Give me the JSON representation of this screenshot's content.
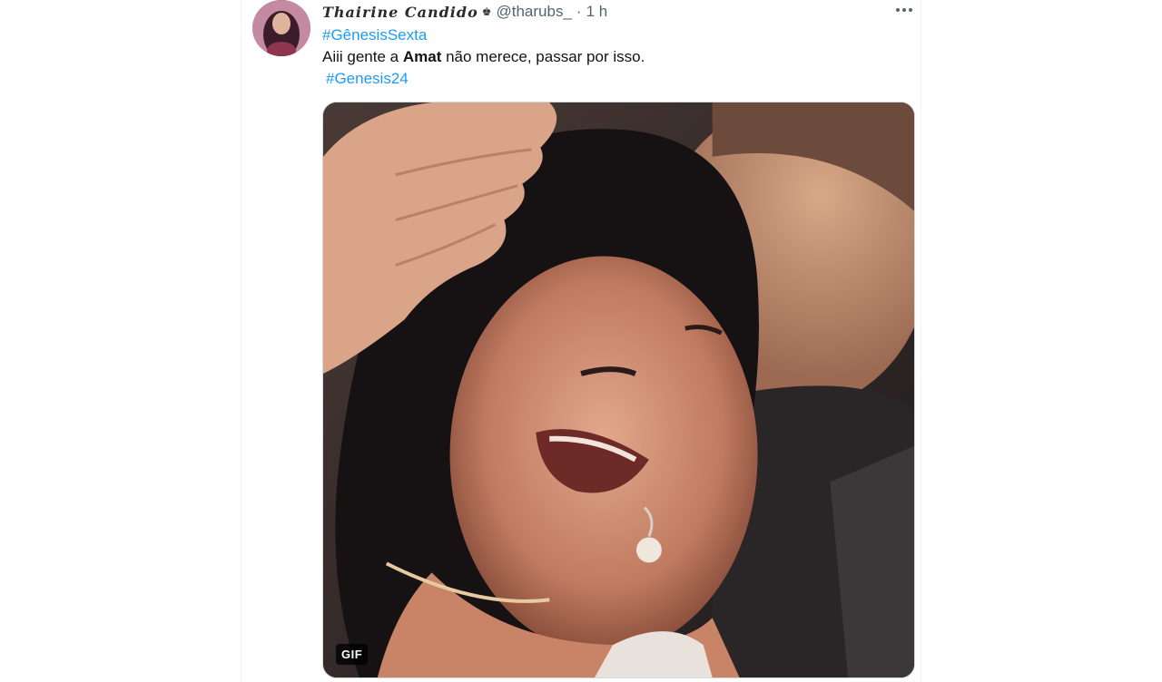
{
  "tweet": {
    "display_name": "Thairine Candido",
    "name_badge_icon": "crown-icon",
    "handle": "@tharubs_",
    "separator": "·",
    "time": "1 h",
    "more_icon": "more-horizontal-icon",
    "hashtag_1": "#GênesisSexta",
    "text_before": "Aiii gente a ",
    "text_bold": "Amat",
    "text_after": " não merece, passar por isso.",
    "hashtag_2": "#Genesis24",
    "media": {
      "type": "gif",
      "badge": "GIF",
      "description_icon": "gif-image"
    }
  },
  "colors": {
    "link": "#1d9bf0",
    "secondary_text": "#536471",
    "primary_text": "#0f1419",
    "border": "#cfd9de"
  }
}
